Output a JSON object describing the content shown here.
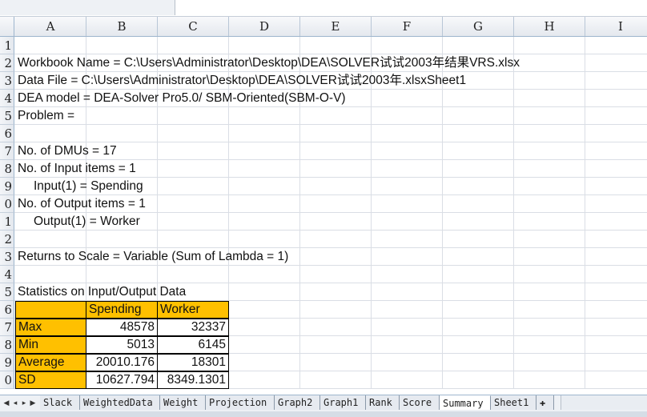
{
  "columns": [
    "A",
    "B",
    "C",
    "D",
    "E",
    "F",
    "G",
    "H",
    "I"
  ],
  "rows": [
    {
      "n": "1",
      "text": ""
    },
    {
      "n": "2",
      "text": "Workbook Name = C:\\Users\\Administrator\\Desktop\\DEA\\SOLVER试试2003年结果VRS.xlsx"
    },
    {
      "n": "3",
      "text": "Data File = C:\\Users\\Administrator\\Desktop\\DEA\\SOLVER试试2003年.xlsxSheet1"
    },
    {
      "n": "4",
      "text": "DEA model =  DEA-Solver Pro5.0/ SBM-Oriented(SBM-O-V)"
    },
    {
      "n": "5",
      "text": "Problem ="
    },
    {
      "n": "6",
      "text": ""
    },
    {
      "n": "7",
      "text": "No. of DMUs = 17"
    },
    {
      "n": "8",
      "text": "No. of Input items = 1"
    },
    {
      "n": "9",
      "text": "Input(1) = Spending",
      "indent": true
    },
    {
      "n": "0",
      "text": "No. of Output items = 1"
    },
    {
      "n": "1",
      "text": "Output(1) = Worker",
      "indent": true
    },
    {
      "n": "2",
      "text": ""
    },
    {
      "n": "3",
      "text": "Returns to Scale = Variable (Sum of Lambda = 1)"
    },
    {
      "n": "4",
      "text": ""
    },
    {
      "n": "5",
      "text": "Statistics on Input/Output Data"
    }
  ],
  "stats": {
    "header": [
      "",
      "Spending",
      "Worker"
    ],
    "rows_h": [
      "6",
      "7",
      "8",
      "9",
      "0"
    ],
    "rows": [
      [
        "Max",
        "48578",
        "32337"
      ],
      [
        "Min",
        "5013",
        "6145"
      ],
      [
        "Average",
        "20010.176",
        "18301"
      ],
      [
        "SD",
        "10627.794",
        "8349.1301"
      ]
    ]
  },
  "tabs": [
    "Slack",
    "WeightedData",
    "Weight",
    "Projection",
    "Graph2",
    "Graph1",
    "Rank",
    "Score",
    "Summary",
    "Sheet1"
  ],
  "active_tab": "Summary",
  "colors": {
    "highlight": "#ffc000"
  }
}
